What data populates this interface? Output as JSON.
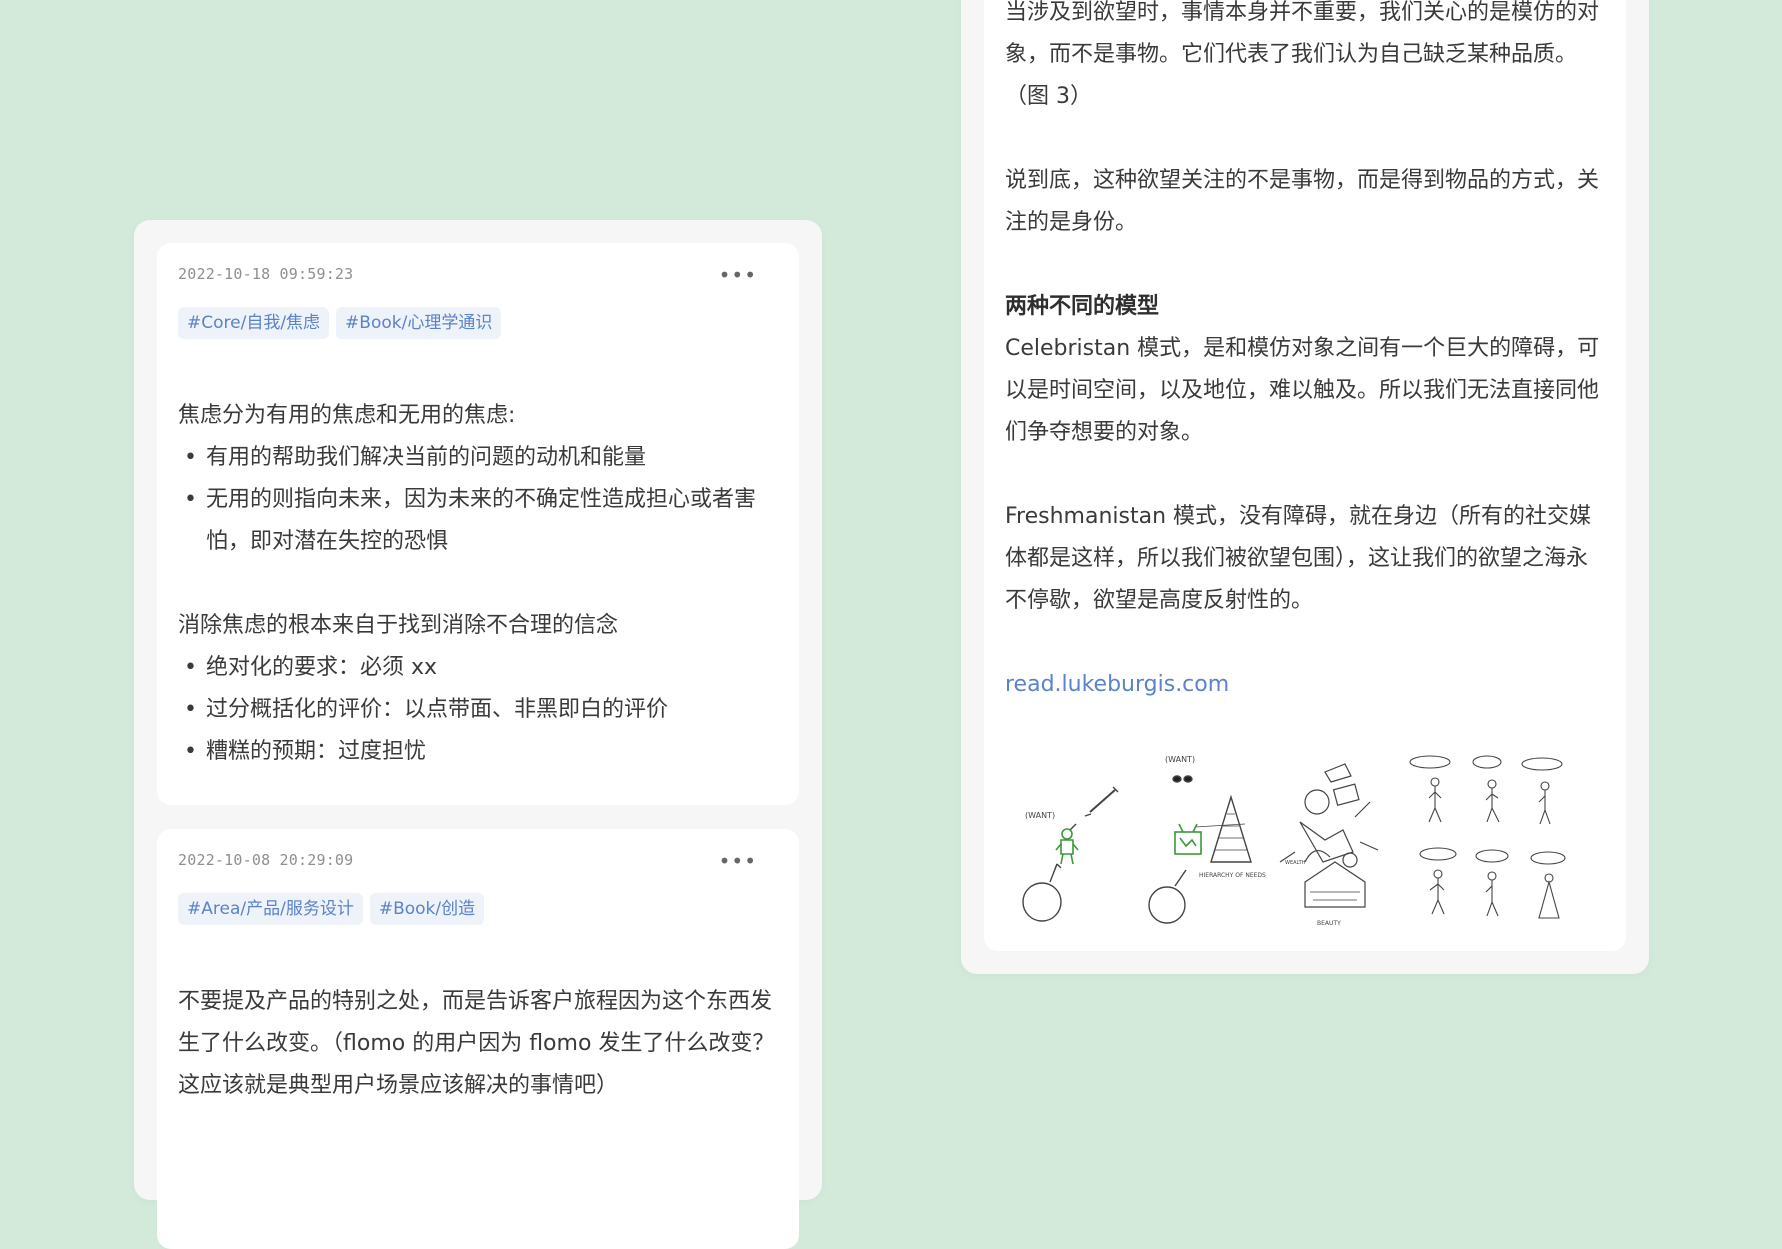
{
  "left_notes": [
    {
      "timestamp": "2022-10-18 09:59:23",
      "more": "•••",
      "tags": [
        "#Core/自我/焦虑",
        "#Book/心理学通识"
      ],
      "intro": "焦虑分为有用的焦虑和无用的焦虑:",
      "bullets_1": [
        "有用的帮助我们解决当前的问题的动机和能量",
        "无用的则指向未来，因为未来的不确定性造成担心或者害怕，即对潜在失控的恐惧"
      ],
      "intro_2": "消除焦虑的根本来自于找到消除不合理的信念",
      "bullets_2": [
        "绝对化的要求：必须 xx",
        "过分概括化的评价：以点带面、非黑即白的评价",
        "糟糕的预期：过度担忧"
      ]
    },
    {
      "timestamp": "2022-10-08 20:29:09",
      "more": "•••",
      "tags": [
        "#Area/产品/服务设计",
        "#Book/创造"
      ],
      "body": "不要提及产品的特别之处，而是告诉客户旅程因为这个东西发生了什么改变。（flomo 的用户因为 flomo 发生了什么改变？这应该就是典型用户场景应该解决的事情吧）"
    }
  ],
  "right_note": {
    "para_1": "当涉及到欲望时，事情本身并不重要，我们关心的是模仿的对象，而不是事物。它们代表了我们认为自己缺乏某种品质。（图 3）",
    "para_2": "说到底，这种欲望关注的不是事物，而是得到物品的方式，关注的是身份。",
    "heading": "两种不同的模型",
    "para_3": "Celebristan 模式，是和模仿对象之间有一个巨大的障碍，可以是时间空间，以及地位，难以触及。所以我们无法直接同他们争夺想要的对象。",
    "para_4": "Freshmanistan 模式，没有障碍，就在身边（所有的社交媒体都是这样，所以我们被欲望包围），这让我们的欲望之海永不停歇，欲望是高度反射性的。",
    "link": "read.lukeburgis.com"
  },
  "colors": {
    "background": "#d3eadb",
    "panel": "#f6f6f7",
    "card": "#ffffff",
    "tag_bg": "#eef2f9",
    "tag_text": "#5b83c9",
    "link": "#5b83c9",
    "sketch_green": "#3a9a3a"
  }
}
